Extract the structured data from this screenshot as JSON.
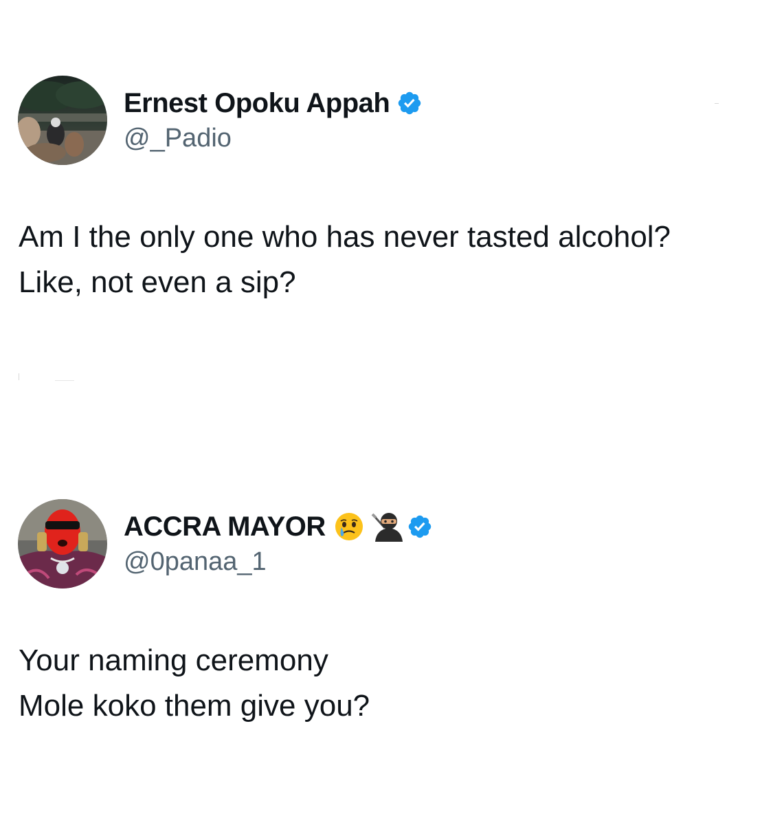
{
  "tweets": [
    {
      "display_name": "Ernest Opoku Appah",
      "handle": "@_Padio",
      "verified": true,
      "avatar_icon": "avatar-night-park-photo",
      "name_emojis": [],
      "text_lines": [
        "Am I the only one who has never tasted alcohol?",
        "Like, not even a sip?"
      ]
    },
    {
      "display_name": "ACCRA MAYOR",
      "handle": "@0panaa_1",
      "verified": true,
      "avatar_icon": "avatar-red-mask-photo",
      "name_emojis": [
        "face-holding-back-tears-emoji",
        "ninja-emoji"
      ],
      "text_lines": [
        "Your naming ceremony",
        "Mole koko them give you?"
      ]
    }
  ],
  "colors": {
    "verified_blue": "#1d9bf0",
    "handle_gray": "#536471",
    "text": "#0f1419"
  }
}
